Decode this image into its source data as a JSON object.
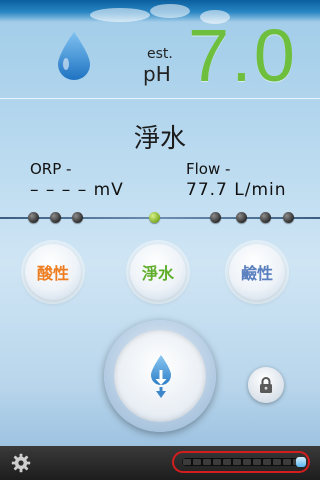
{
  "header": {
    "est_label": "est.",
    "ph_label": "pH",
    "ph_value": "7.0",
    "icon": "water-drop-icon"
  },
  "mode": {
    "title": "淨水"
  },
  "readings": {
    "orp_label": "ORP -",
    "orp_value": "– – – –  mV",
    "flow_label": "Flow -",
    "flow_value": "77.7  L/min"
  },
  "level_indicator": {
    "dot_count": 8,
    "active_index": 3
  },
  "mode_buttons": [
    {
      "label": "酸性",
      "color": "#ee7d22"
    },
    {
      "label": "淨水",
      "color": "#5fae2b"
    },
    {
      "label": "鹼性",
      "color": "#5a7fbf"
    }
  ],
  "controls": {
    "main_button_icon": "water-drop-download-icon",
    "lock_icon": "lock-icon",
    "settings_icon": "gear-icon"
  },
  "bottom_level": {
    "fill_fraction": 0.08,
    "frame_color": "#d21e1e"
  }
}
